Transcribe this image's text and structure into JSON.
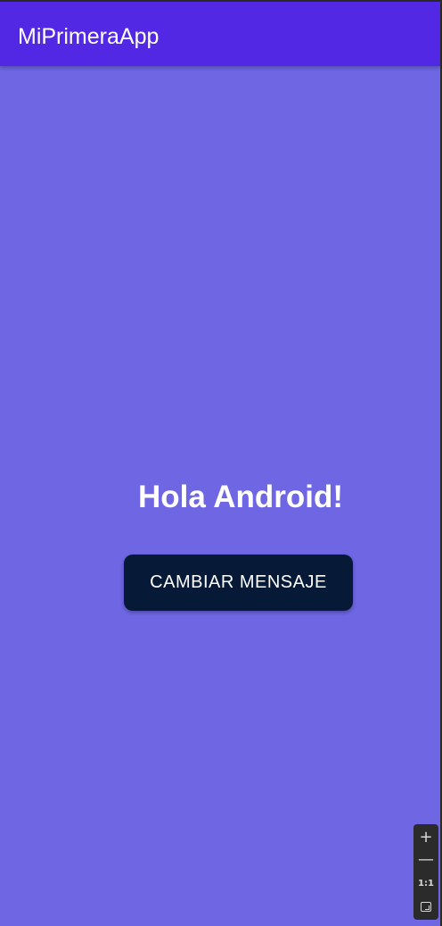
{
  "app_bar": {
    "title": "MiPrimeraApp"
  },
  "main": {
    "message": "Hola Android!",
    "button_label": "CAMBIAR MENSAJE"
  },
  "zoom_controls": {
    "zoom_in_icon": "+",
    "zoom_out_icon": "—",
    "reset_label": "1:1",
    "fit_icon": "fit-screen-icon"
  },
  "colors": {
    "app_bar": "#5328e4",
    "background": "#6e66e3",
    "button": "#061a38",
    "text": "#ffffff",
    "toolbar": "#2b2b2b"
  }
}
